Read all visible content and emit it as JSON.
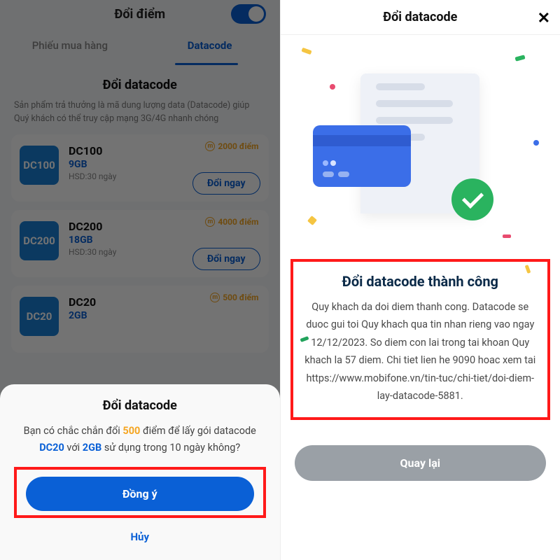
{
  "left": {
    "header_title": "Đổi điểm",
    "tabs": {
      "voucher": "Phiếu mua hàng",
      "datacode": "Datacode"
    },
    "section_title": "Đổi datacode",
    "subtitle": "Sản phẩm trả thưởng là mã dung lượng data (Datacode) giúp Quý khách có thể truy cập mạng 3G/4G nhanh chóng",
    "items": [
      {
        "code": "DC100",
        "name": "DC100",
        "volume": "9GB",
        "hsd": "HSD:30 ngày",
        "points": "2000 điểm",
        "action": "Đổi ngay"
      },
      {
        "code": "DC200",
        "name": "DC200",
        "volume": "18GB",
        "hsd": "HSD:30 ngày",
        "points": "4000 điểm",
        "action": "Đổi ngay"
      },
      {
        "code": "DC20",
        "name": "DC20",
        "volume": "2GB",
        "hsd": "",
        "points": "500 điểm",
        "action": ""
      }
    ],
    "modal": {
      "title": "Đổi datacode",
      "text_pre": "Bạn có chắc chắn đổi ",
      "points": "500",
      "text_mid": " điểm để lấy gói datacode ",
      "code": "DC20",
      "text_with": " với ",
      "vol": "2GB",
      "text_post": " sử dụng trong 10 ngày không?",
      "confirm": "Đồng ý",
      "cancel": "Hủy"
    }
  },
  "right": {
    "header_title": "Đổi datacode",
    "success_title": "Đổi datacode thành công",
    "success_text": "Quy khach da doi diem thanh cong. Datacode se duoc gui toi Quy khach qua tin nhan rieng vao ngay 12/12/2023. So diem con lai trong tai khoan Quy khach la 57 diem. Chi tiet lien he 9090 hoac xem tai https://www.mobifone.vn/tin-tuc/chi-tiet/doi-diem-lay-datacode-5881.",
    "back": "Quay lại"
  }
}
